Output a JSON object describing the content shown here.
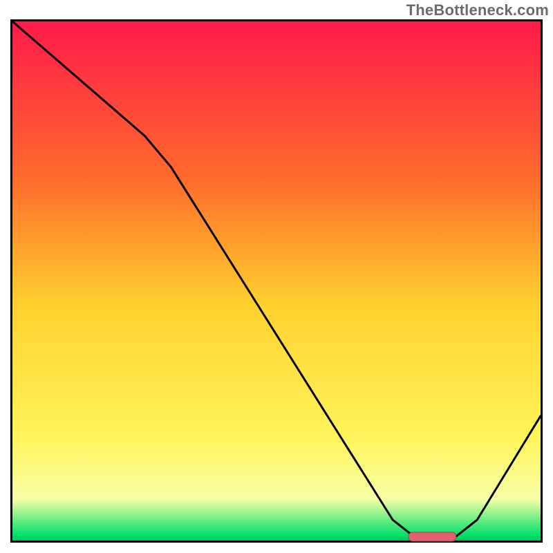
{
  "watermark": "TheBottleneck.com",
  "colors": {
    "gradient_top": "#ff1a4b",
    "gradient_upper": "#ff6a2b",
    "gradient_mid": "#ffd22e",
    "gradient_low1": "#fff45a",
    "gradient_low2": "#f7ffa6",
    "gradient_green": "#00e06a",
    "frame": "#000000",
    "curve": "#000000",
    "marker_fill": "#e0606e",
    "marker_stroke": "#a9444f"
  },
  "chart_data": {
    "type": "line",
    "title": "",
    "xlabel": "",
    "ylabel": "",
    "xlim": [
      0,
      100
    ],
    "ylim": [
      0,
      100
    ],
    "notes": "Bottleneck-style curve: y is mismatch percentage (high=red, low=green). Curve descends from top-left, reaches zero near x≈80, then rises again. Optimal zone marked at the trough.",
    "curve": [
      {
        "x": 0,
        "y": 100
      },
      {
        "x": 25,
        "y": 78
      },
      {
        "x": 30,
        "y": 72
      },
      {
        "x": 72,
        "y": 4
      },
      {
        "x": 76,
        "y": 0.8
      },
      {
        "x": 84,
        "y": 0.8
      },
      {
        "x": 88,
        "y": 4
      },
      {
        "x": 100,
        "y": 24
      }
    ],
    "optimal_marker": {
      "x_start": 75,
      "x_end": 84,
      "y": 0.8
    }
  }
}
